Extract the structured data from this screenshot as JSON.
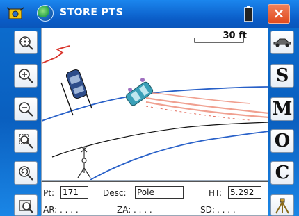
{
  "window": {
    "title": "STORE PTS",
    "close_label": "×"
  },
  "map": {
    "scale_label": "30 ft"
  },
  "right_toolbar": {
    "s": "S",
    "m": "M",
    "o": "O",
    "c": "C"
  },
  "info": {
    "pt_label": "Pt:",
    "pt_value": "171",
    "desc_label": "Desc:",
    "desc_value": "Pole",
    "ht_label": "HT:",
    "ht_value": "5.292",
    "ar_label": "AR:",
    "ar_value": ". . . .",
    "za_label": "ZA:",
    "za_value": ". . . .",
    "sd_label": "SD:",
    "sd_value": ". . . ."
  },
  "colors": {
    "accent": "#0a5cc7",
    "close": "#e04a1d"
  }
}
